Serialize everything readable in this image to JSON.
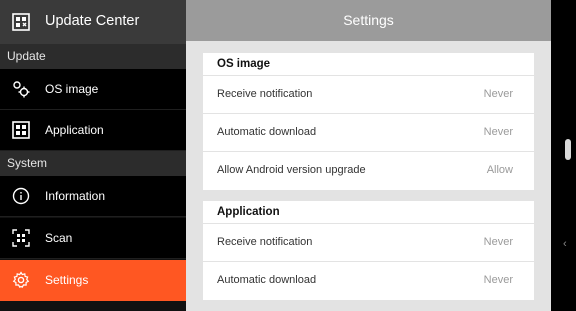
{
  "sidebar": {
    "app_title": "Update Center",
    "sections": [
      {
        "label": "Update",
        "items": [
          {
            "label": "OS image",
            "icon": "os-image-icon"
          },
          {
            "label": "Application",
            "icon": "application-grid-icon"
          }
        ]
      },
      {
        "label": "System",
        "items": [
          {
            "label": "Information",
            "icon": "info-icon"
          },
          {
            "label": "Scan",
            "icon": "scan-icon"
          },
          {
            "label": "Settings",
            "icon": "gear-icon",
            "active": true
          }
        ]
      }
    ]
  },
  "main": {
    "title": "Settings",
    "cards": [
      {
        "title": "OS image",
        "rows": [
          {
            "label": "Receive notification",
            "value": "Never"
          },
          {
            "label": "Automatic download",
            "value": "Never"
          },
          {
            "label": "Allow Android version upgrade",
            "value": "Allow"
          }
        ]
      },
      {
        "title": "Application",
        "rows": [
          {
            "label": "Receive notification",
            "value": "Never"
          },
          {
            "label": "Automatic download",
            "value": "Never"
          }
        ]
      }
    ]
  },
  "rail": {
    "arrow_glyph": "‹"
  },
  "colors": {
    "accent": "#ff5722",
    "sidebar_bg": "#000000",
    "header_bg": "#9b9b9b",
    "content_bg": "#e3e3e3"
  }
}
